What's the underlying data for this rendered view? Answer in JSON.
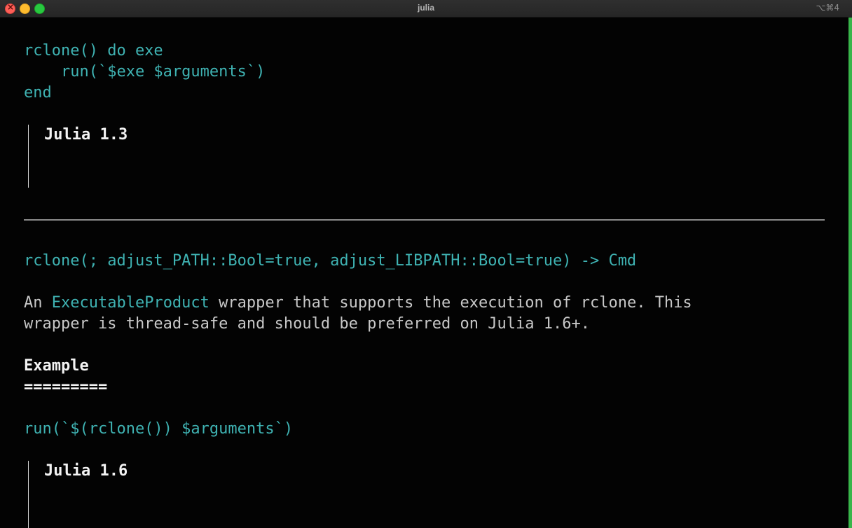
{
  "window": {
    "title": "julia",
    "shortcut": "⌥⌘4",
    "accent_color": "#39b54a"
  },
  "colors": {
    "code": "#3fb3b3",
    "text": "#c8c8c8",
    "heading": "#f3f3f3",
    "background": "#030303"
  },
  "terminal": {
    "code_block_1": {
      "line1": "rclone() do exe",
      "line2": "    run(`$exe $arguments`)",
      "line3": "end"
    },
    "admonition_1": {
      "title": "Julia 1.3"
    },
    "signature": "rclone(; adjust_PATH::Bool=true, adjust_LIBPATH::Bool=true) -> Cmd",
    "description": {
      "prefix": "An ",
      "link": "ExecutableProduct",
      "rest_line1": " wrapper that supports the execution of rclone. This",
      "line2": "wrapper is thread-safe and should be preferred on Julia 1.6+."
    },
    "example": {
      "heading": "Example",
      "underline": "========="
    },
    "code_block_2": "run(`$(rclone()) $arguments`)",
    "admonition_2": {
      "title": "Julia 1.6"
    }
  }
}
